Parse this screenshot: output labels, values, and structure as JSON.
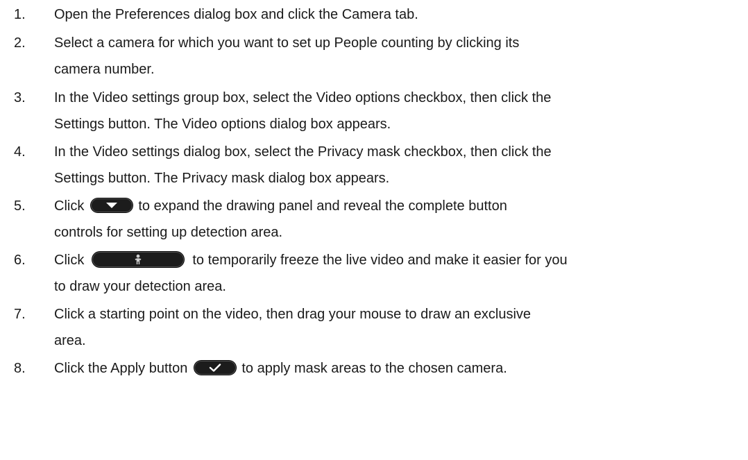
{
  "steps": [
    {
      "number": "1.",
      "lines": [
        "Open the Preferences dialog box and click the Camera tab."
      ]
    },
    {
      "number": "2.",
      "lines": [
        "Select a camera for which you want to set up People counting by clicking its",
        "camera number."
      ]
    },
    {
      "number": "3.",
      "lines": [
        "In the Video settings group box, select the Video options checkbox, then click the",
        "Settings button. The Video options dialog box appears."
      ]
    },
    {
      "number": "4.",
      "lines": [
        "In the Video settings dialog box, select the Privacy mask checkbox, then click the",
        "Settings button. The Privacy mask dialog box appears."
      ]
    },
    {
      "number": "5.",
      "before": "Click",
      "after": "to expand the drawing panel and reveal the complete button",
      "line2": "controls for setting up detection area."
    },
    {
      "number": "6.",
      "before": "Click",
      "after": "to temporarily freeze the live video and make it easier for you",
      "line2": "to draw your detection area."
    },
    {
      "number": "7.",
      "lines": [
        "Click a starting point on the video, then drag your mouse to draw an exclusive",
        "area."
      ]
    },
    {
      "number": "8.",
      "before": "Click the Apply button",
      "after": "to apply mask areas to the chosen camera."
    }
  ],
  "icons": {
    "expand": "chevron-down-icon",
    "freeze": "person-icon",
    "apply": "checkmark-icon"
  }
}
